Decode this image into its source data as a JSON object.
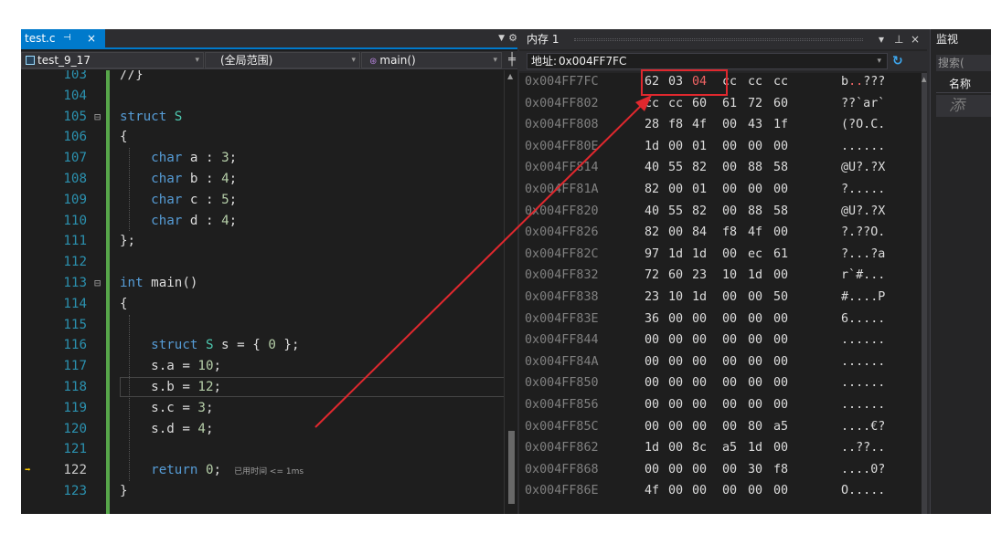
{
  "editor": {
    "tab": {
      "label": "test.c",
      "pin": "⊣",
      "close": "×"
    },
    "nav": {
      "project": "test_9_17",
      "scope": "(全局范围)",
      "function": "main()"
    },
    "perf_tip": "已用时间 <= 1ms",
    "lines": [
      {
        "n": "103",
        "fold": "",
        "html": "<span class=\"kw\"></span>//}"
      },
      {
        "n": "104",
        "fold": "",
        "text": ""
      },
      {
        "n": "105",
        "fold": "⊟",
        "parts": [
          [
            "kw",
            "struct"
          ],
          [
            "",
            " "
          ],
          [
            "ty",
            "S"
          ]
        ]
      },
      {
        "n": "106",
        "fold": "",
        "parts": [
          [
            "",
            "{"
          ]
        ]
      },
      {
        "n": "107",
        "fold": "",
        "parts": [
          [
            "",
            "    "
          ],
          [
            "kw",
            "char"
          ],
          [
            "",
            " a : "
          ],
          [
            "num",
            "3"
          ],
          [
            "",
            ";"
          ]
        ]
      },
      {
        "n": "108",
        "fold": "",
        "parts": [
          [
            "",
            "    "
          ],
          [
            "kw",
            "char"
          ],
          [
            "",
            " b : "
          ],
          [
            "num",
            "4"
          ],
          [
            "",
            ";"
          ]
        ]
      },
      {
        "n": "109",
        "fold": "",
        "parts": [
          [
            "",
            "    "
          ],
          [
            "kw",
            "char"
          ],
          [
            "",
            " c : "
          ],
          [
            "num",
            "5"
          ],
          [
            "",
            ";"
          ]
        ]
      },
      {
        "n": "110",
        "fold": "",
        "parts": [
          [
            "",
            "    "
          ],
          [
            "kw",
            "char"
          ],
          [
            "",
            " d : "
          ],
          [
            "num",
            "4"
          ],
          [
            "",
            ";"
          ]
        ]
      },
      {
        "n": "111",
        "fold": "",
        "parts": [
          [
            "",
            "};"
          ]
        ]
      },
      {
        "n": "112",
        "fold": "",
        "parts": []
      },
      {
        "n": "113",
        "fold": "⊟",
        "parts": [
          [
            "kw",
            "int"
          ],
          [
            "",
            " main()"
          ]
        ]
      },
      {
        "n": "114",
        "fold": "",
        "parts": [
          [
            "",
            "{"
          ]
        ]
      },
      {
        "n": "115",
        "fold": "",
        "parts": []
      },
      {
        "n": "116",
        "fold": "",
        "parts": [
          [
            "",
            "    "
          ],
          [
            "kw",
            "struct"
          ],
          [
            "",
            " "
          ],
          [
            "ty",
            "S"
          ],
          [
            "",
            " s = { "
          ],
          [
            "num",
            "0"
          ],
          [
            "",
            " };"
          ]
        ]
      },
      {
        "n": "117",
        "fold": "",
        "parts": [
          [
            "",
            "    s.a = "
          ],
          [
            "num",
            "10"
          ],
          [
            "",
            ";"
          ]
        ]
      },
      {
        "n": "118",
        "fold": "",
        "parts": [
          [
            "",
            "    s.b = "
          ],
          [
            "num",
            "12"
          ],
          [
            "",
            ";"
          ]
        ]
      },
      {
        "n": "119",
        "fold": "",
        "parts": [
          [
            "",
            "    s.c = "
          ],
          [
            "num",
            "3"
          ],
          [
            "",
            ";"
          ]
        ]
      },
      {
        "n": "120",
        "fold": "",
        "parts": [
          [
            "",
            "    s.d = "
          ],
          [
            "num",
            "4"
          ],
          [
            "",
            ";"
          ]
        ]
      },
      {
        "n": "121",
        "fold": "",
        "parts": []
      },
      {
        "n": "122",
        "fold": "",
        "parts": [
          [
            "",
            "    "
          ],
          [
            "kw",
            "return"
          ],
          [
            "",
            " "
          ],
          [
            "num",
            "0"
          ],
          [
            "",
            ";"
          ]
        ]
      },
      {
        "n": "123",
        "fold": "",
        "parts": [
          [
            "",
            "}"
          ]
        ]
      }
    ]
  },
  "memory": {
    "title": "内存 1",
    "controls": {
      "dropdown": "▾",
      "pin": "⊥",
      "close": "×"
    },
    "address_label": "地址:",
    "address_value": "0x004FF7FC",
    "rows": [
      {
        "addr": "0x004FF7FC",
        "bytes": [
          "62",
          "03",
          "04",
          "cc",
          "cc",
          "cc"
        ],
        "ascii": [
          "b",
          ".",
          ".",
          "???"
        ],
        "hot_bytes": [
          0,
          1,
          2
        ],
        "hot_ascii": [
          1,
          2
        ]
      },
      {
        "addr": "0x004FF802",
        "bytes": [
          "cc",
          "cc",
          "60",
          "61",
          "72",
          "60"
        ],
        "ascii": [
          "??`ar`"
        ]
      },
      {
        "addr": "0x004FF808",
        "bytes": [
          "28",
          "f8",
          "4f",
          "00",
          "43",
          "1f"
        ],
        "ascii": [
          "(?O.C."
        ]
      },
      {
        "addr": "0x004FF80E",
        "bytes": [
          "1d",
          "00",
          "01",
          "00",
          "00",
          "00"
        ],
        "ascii": [
          "......"
        ]
      },
      {
        "addr": "0x004FF814",
        "bytes": [
          "40",
          "55",
          "82",
          "00",
          "88",
          "58"
        ],
        "ascii": [
          "@U?.?X"
        ]
      },
      {
        "addr": "0x004FF81A",
        "bytes": [
          "82",
          "00",
          "01",
          "00",
          "00",
          "00"
        ],
        "ascii": [
          "?....."
        ]
      },
      {
        "addr": "0x004FF820",
        "bytes": [
          "40",
          "55",
          "82",
          "00",
          "88",
          "58"
        ],
        "ascii": [
          "@U?.?X"
        ]
      },
      {
        "addr": "0x004FF826",
        "bytes": [
          "82",
          "00",
          "84",
          "f8",
          "4f",
          "00"
        ],
        "ascii": [
          "?.??O."
        ]
      },
      {
        "addr": "0x004FF82C",
        "bytes": [
          "97",
          "1d",
          "1d",
          "00",
          "ec",
          "61"
        ],
        "ascii": [
          "?...?a"
        ]
      },
      {
        "addr": "0x004FF832",
        "bytes": [
          "72",
          "60",
          "23",
          "10",
          "1d",
          "00"
        ],
        "ascii": [
          "r`#..."
        ]
      },
      {
        "addr": "0x004FF838",
        "bytes": [
          "23",
          "10",
          "1d",
          "00",
          "00",
          "50"
        ],
        "ascii": [
          "#....P"
        ]
      },
      {
        "addr": "0x004FF83E",
        "bytes": [
          "36",
          "00",
          "00",
          "00",
          "00",
          "00"
        ],
        "ascii": [
          "6....."
        ]
      },
      {
        "addr": "0x004FF844",
        "bytes": [
          "00",
          "00",
          "00",
          "00",
          "00",
          "00"
        ],
        "ascii": [
          "......"
        ]
      },
      {
        "addr": "0x004FF84A",
        "bytes": [
          "00",
          "00",
          "00",
          "00",
          "00",
          "00"
        ],
        "ascii": [
          "......"
        ]
      },
      {
        "addr": "0x004FF850",
        "bytes": [
          "00",
          "00",
          "00",
          "00",
          "00",
          "00"
        ],
        "ascii": [
          "......"
        ]
      },
      {
        "addr": "0x004FF856",
        "bytes": [
          "00",
          "00",
          "00",
          "00",
          "00",
          "00"
        ],
        "ascii": [
          "......"
        ]
      },
      {
        "addr": "0x004FF85C",
        "bytes": [
          "00",
          "00",
          "00",
          "00",
          "80",
          "a5"
        ],
        "ascii": [
          "....€?"
        ]
      },
      {
        "addr": "0x004FF862",
        "bytes": [
          "1d",
          "00",
          "8c",
          "a5",
          "1d",
          "00"
        ],
        "ascii": [
          "..??.."
        ]
      },
      {
        "addr": "0x004FF868",
        "bytes": [
          "00",
          "00",
          "00",
          "00",
          "30",
          "f8"
        ],
        "ascii": [
          "....0?"
        ]
      },
      {
        "addr": "0x004FF86E",
        "bytes": [
          "4f",
          "00",
          "00",
          "00",
          "00",
          "00"
        ],
        "ascii": [
          "O....."
        ]
      }
    ]
  },
  "watch": {
    "title": "监视",
    "search_placeholder": "搜索(",
    "name_header": "名称",
    "add_row": "添"
  },
  "colors": {
    "annotation": "#e0282e",
    "accent": "#007acc"
  }
}
